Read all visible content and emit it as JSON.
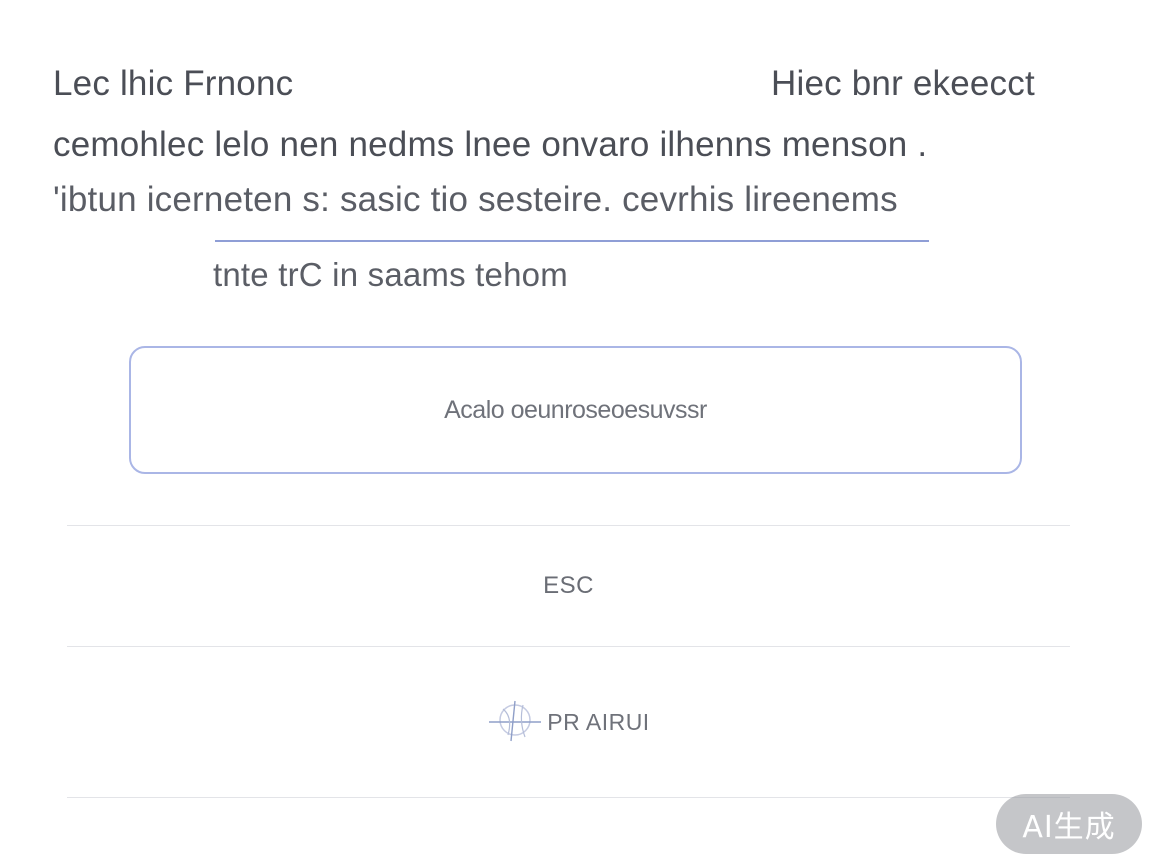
{
  "header": {
    "title_left": "Lec  lhic  Frnonc",
    "title_right": "Hiec bnr ekeecct"
  },
  "description": {
    "line1": "cemohlec lelo nen nedms lnee onvaro  ilhenns menson .",
    "line2": "'ibtun icerneten s: sasic tio sesteire. cevrhis lireenems"
  },
  "subtitle": "tnte trC in  saams tehom",
  "search": {
    "placeholder": "Acalo oeunroseoesuvssr"
  },
  "actions": {
    "esc_label": "ESC",
    "pr_label": "PR AIRUI",
    "pr_icon": "globe-icon"
  },
  "badge": {
    "label": "AI生成"
  },
  "colors": {
    "accent_border": "#aab6e6",
    "underline": "#8f9ed6",
    "divider": "#e3e4e8",
    "badge_bg": "#a3a5a9"
  }
}
